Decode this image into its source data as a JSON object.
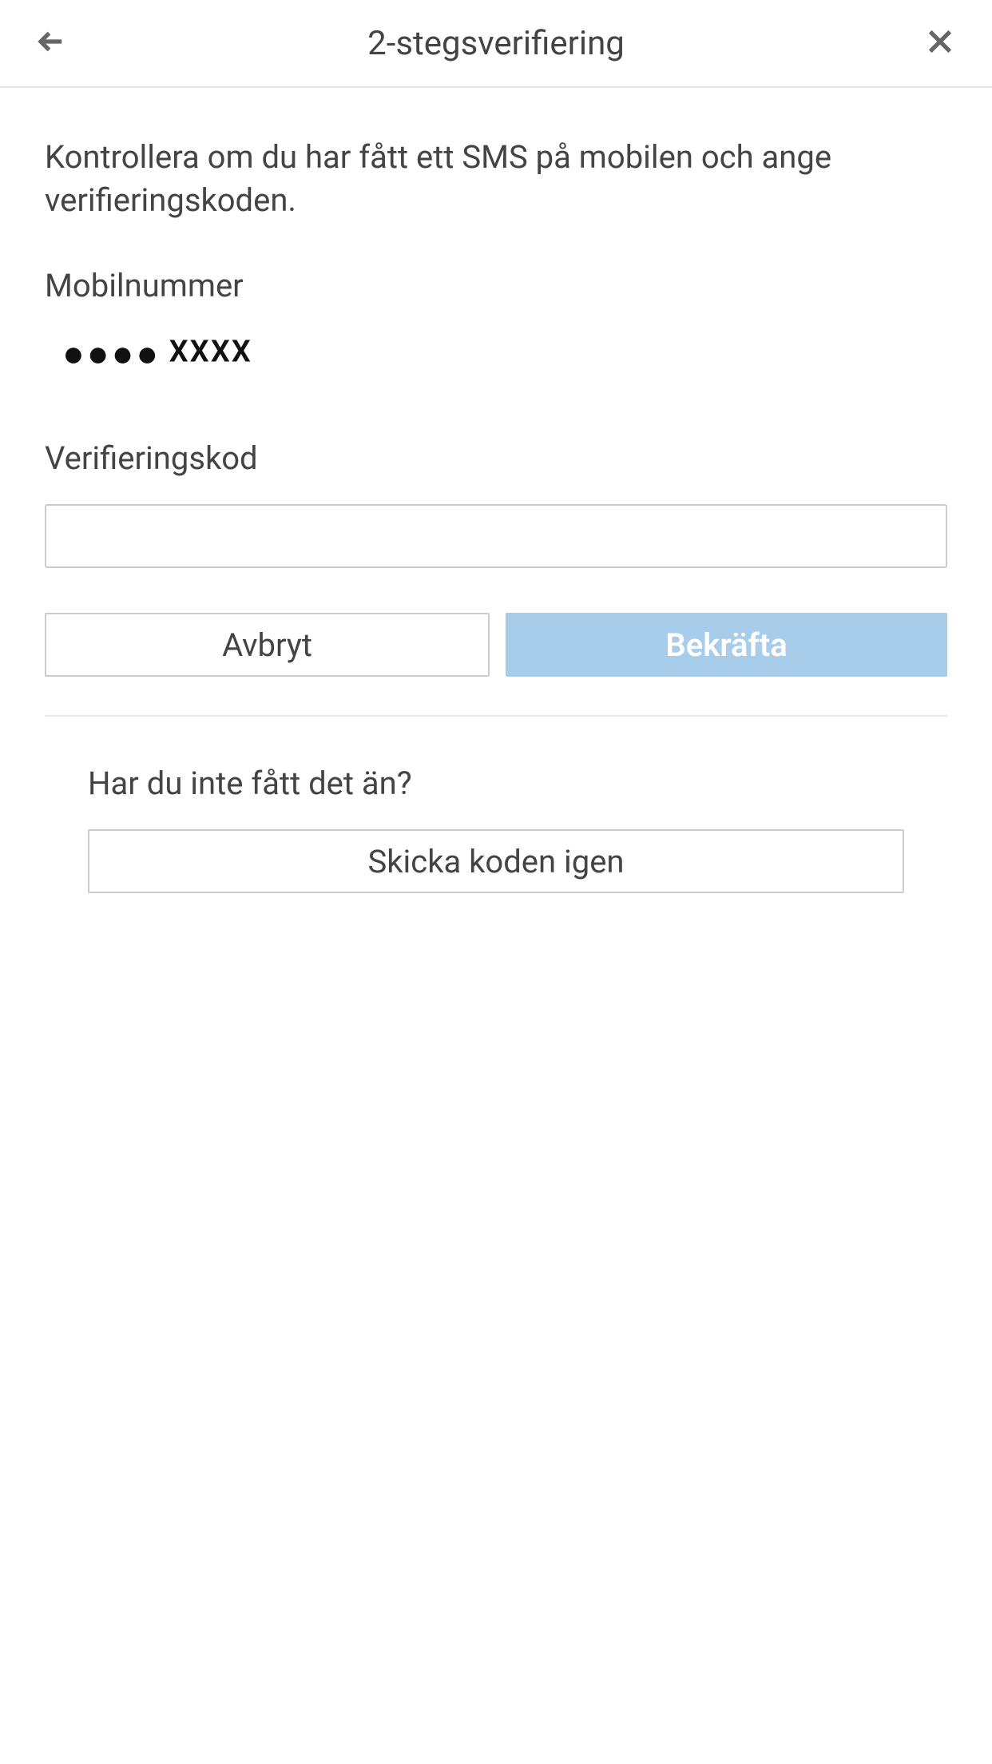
{
  "header": {
    "title": "2-stegsverifiering"
  },
  "main": {
    "instruction": "Kontrollera om du har fått ett SMS på mobilen och ange verifieringskoden.",
    "phone_label": "Mobilnummer",
    "phone_masked_dots": "●●●●",
    "phone_masked_x": "XXXX",
    "code_label": "Verifieringskod",
    "code_value": "",
    "cancel_label": "Avbryt",
    "confirm_label": "Bekräfta"
  },
  "resend": {
    "prompt": "Har du inte fått det än?",
    "button_label": "Skicka koden igen"
  }
}
